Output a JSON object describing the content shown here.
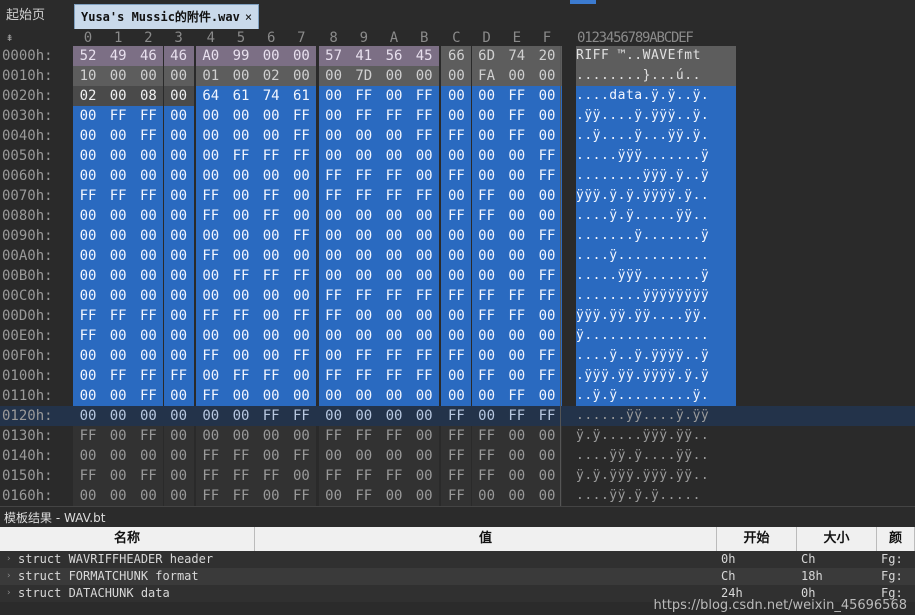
{
  "tabs": {
    "start": "起始页",
    "file": "Yusa's Mussic的附件.wav",
    "close": "×"
  },
  "column_headers": [
    "0",
    "1",
    "2",
    "3",
    "4",
    "5",
    "6",
    "7",
    "8",
    "9",
    "A",
    "B",
    "C",
    "D",
    "E",
    "F"
  ],
  "ascii_header": "0123456789ABCDEF",
  "scroll_up_icon": "⇞",
  "rows": [
    {
      "addr": "0000h:",
      "hex": [
        "52",
        "49",
        "46",
        "46",
        "A0",
        "99",
        "00",
        "00",
        "57",
        "41",
        "56",
        "45",
        "66",
        "6D",
        "74",
        "20"
      ],
      "ascii": "RIFF ™..WAVEfmt "
    },
    {
      "addr": "0010h:",
      "hex": [
        "10",
        "00",
        "00",
        "00",
        "01",
        "00",
        "02",
        "00",
        "00",
        "7D",
        "00",
        "00",
        "00",
        "FA",
        "00",
        "00"
      ],
      "ascii": "........}...ú.."
    },
    {
      "addr": "0020h:",
      "hex": [
        "02",
        "00",
        "08",
        "00",
        "64",
        "61",
        "74",
        "61",
        "00",
        "FF",
        "00",
        "FF",
        "00",
        "00",
        "FF",
        "00"
      ],
      "ascii": "....data.ÿ.ÿ..ÿ."
    },
    {
      "addr": "0030h:",
      "hex": [
        "00",
        "FF",
        "FF",
        "00",
        "00",
        "00",
        "00",
        "FF",
        "00",
        "FF",
        "FF",
        "FF",
        "00",
        "00",
        "FF",
        "00"
      ],
      "ascii": ".ÿÿ....ÿ.ÿÿÿ..ÿ."
    },
    {
      "addr": "0040h:",
      "hex": [
        "00",
        "00",
        "FF",
        "00",
        "00",
        "00",
        "00",
        "FF",
        "00",
        "00",
        "00",
        "FF",
        "FF",
        "00",
        "FF",
        "00"
      ],
      "ascii": "..ÿ....ÿ...ÿÿ.ÿ."
    },
    {
      "addr": "0050h:",
      "hex": [
        "00",
        "00",
        "00",
        "00",
        "00",
        "FF",
        "FF",
        "FF",
        "00",
        "00",
        "00",
        "00",
        "00",
        "00",
        "00",
        "FF"
      ],
      "ascii": ".....ÿÿÿ.......ÿ"
    },
    {
      "addr": "0060h:",
      "hex": [
        "00",
        "00",
        "00",
        "00",
        "00",
        "00",
        "00",
        "00",
        "FF",
        "FF",
        "FF",
        "00",
        "FF",
        "00",
        "00",
        "FF"
      ],
      "ascii": "........ÿÿÿ.ÿ..ÿ"
    },
    {
      "addr": "0070h:",
      "hex": [
        "FF",
        "FF",
        "FF",
        "00",
        "FF",
        "00",
        "FF",
        "00",
        "FF",
        "FF",
        "FF",
        "FF",
        "00",
        "FF",
        "00",
        "00"
      ],
      "ascii": "ÿÿÿ.ÿ.ÿ.ÿÿÿÿ.ÿ.."
    },
    {
      "addr": "0080h:",
      "hex": [
        "00",
        "00",
        "00",
        "00",
        "FF",
        "00",
        "FF",
        "00",
        "00",
        "00",
        "00",
        "00",
        "FF",
        "FF",
        "00",
        "00"
      ],
      "ascii": "....ÿ.ÿ.....ÿÿ.."
    },
    {
      "addr": "0090h:",
      "hex": [
        "00",
        "00",
        "00",
        "00",
        "00",
        "00",
        "00",
        "FF",
        "00",
        "00",
        "00",
        "00",
        "00",
        "00",
        "00",
        "FF"
      ],
      "ascii": ".......ÿ.......ÿ"
    },
    {
      "addr": "00A0h:",
      "hex": [
        "00",
        "00",
        "00",
        "00",
        "FF",
        "00",
        "00",
        "00",
        "00",
        "00",
        "00",
        "00",
        "00",
        "00",
        "00",
        "00"
      ],
      "ascii": "....ÿ..........."
    },
    {
      "addr": "00B0h:",
      "hex": [
        "00",
        "00",
        "00",
        "00",
        "00",
        "FF",
        "FF",
        "FF",
        "00",
        "00",
        "00",
        "00",
        "00",
        "00",
        "00",
        "FF"
      ],
      "ascii": ".....ÿÿÿ.......ÿ"
    },
    {
      "addr": "00C0h:",
      "hex": [
        "00",
        "00",
        "00",
        "00",
        "00",
        "00",
        "00",
        "00",
        "FF",
        "FF",
        "FF",
        "FF",
        "FF",
        "FF",
        "FF",
        "FF"
      ],
      "ascii": "........ÿÿÿÿÿÿÿÿ"
    },
    {
      "addr": "00D0h:",
      "hex": [
        "FF",
        "FF",
        "FF",
        "00",
        "FF",
        "FF",
        "00",
        "FF",
        "FF",
        "00",
        "00",
        "00",
        "00",
        "FF",
        "FF",
        "00"
      ],
      "ascii": "ÿÿÿ.ÿÿ.ÿÿ....ÿÿ."
    },
    {
      "addr": "00E0h:",
      "hex": [
        "FF",
        "00",
        "00",
        "00",
        "00",
        "00",
        "00",
        "00",
        "00",
        "00",
        "00",
        "00",
        "00",
        "00",
        "00",
        "00"
      ],
      "ascii": "ÿ..............."
    },
    {
      "addr": "00F0h:",
      "hex": [
        "00",
        "00",
        "00",
        "00",
        "FF",
        "00",
        "00",
        "FF",
        "00",
        "FF",
        "FF",
        "FF",
        "FF",
        "00",
        "00",
        "FF"
      ],
      "ascii": "....ÿ..ÿ.ÿÿÿÿ..ÿ"
    },
    {
      "addr": "0100h:",
      "hex": [
        "00",
        "FF",
        "FF",
        "FF",
        "00",
        "FF",
        "FF",
        "00",
        "FF",
        "FF",
        "FF",
        "FF",
        "00",
        "FF",
        "00",
        "FF"
      ],
      "ascii": ".ÿÿÿ.ÿÿ.ÿÿÿÿ.ÿ.ÿ"
    },
    {
      "addr": "0110h:",
      "hex": [
        "00",
        "00",
        "FF",
        "00",
        "FF",
        "00",
        "00",
        "00",
        "00",
        "00",
        "00",
        "00",
        "00",
        "00",
        "FF",
        "00"
      ],
      "ascii": "..ÿ.ÿ.........ÿ."
    },
    {
      "addr": "0120h:",
      "hex": [
        "00",
        "00",
        "00",
        "00",
        "00",
        "00",
        "FF",
        "FF",
        "00",
        "00",
        "00",
        "00",
        "FF",
        "00",
        "FF",
        "FF"
      ],
      "ascii": "......ÿÿ....ÿ.ÿÿ"
    },
    {
      "addr": "0130h:",
      "hex": [
        "FF",
        "00",
        "FF",
        "00",
        "00",
        "00",
        "00",
        "00",
        "FF",
        "FF",
        "FF",
        "00",
        "FF",
        "FF",
        "00",
        "00"
      ],
      "ascii": "ÿ.ÿ.....ÿÿÿ.ÿÿ.."
    },
    {
      "addr": "0140h:",
      "hex": [
        "00",
        "00",
        "00",
        "00",
        "FF",
        "FF",
        "00",
        "FF",
        "00",
        "00",
        "00",
        "00",
        "FF",
        "FF",
        "00",
        "00"
      ],
      "ascii": "....ÿÿ.ÿ....ÿÿ.."
    },
    {
      "addr": "0150h:",
      "hex": [
        "FF",
        "00",
        "FF",
        "00",
        "FF",
        "FF",
        "FF",
        "00",
        "FF",
        "FF",
        "FF",
        "00",
        "FF",
        "FF",
        "00",
        "00"
      ],
      "ascii": "ÿ.ÿ.ÿÿÿ.ÿÿÿ.ÿÿ.."
    },
    {
      "addr": "0160h:",
      "hex": [
        "00",
        "00",
        "00",
        "00",
        "FF",
        "FF",
        "00",
        "FF",
        "00",
        "FF",
        "00",
        "00",
        "FF",
        "00",
        "00",
        "00"
      ],
      "ascii": "....ÿÿ.ÿ.ÿ....."
    }
  ],
  "colors": {
    "riff_header": "#7c6f85",
    "fmt_chunk": "#5d5d5d",
    "data_tag": "#4a4a4a",
    "data_selected": "#2a6ac0",
    "cursor_row": "#23334a",
    "plain_cell": "#323232"
  },
  "panel": {
    "title": "模板结果 - WAV.bt",
    "columns": [
      "名称",
      "值",
      "开始",
      "大小",
      "颜"
    ],
    "rows": [
      {
        "name": "struct WAVRIFFHEADER header",
        "value": "",
        "start": "0h",
        "size": "Ch",
        "color": "Fg:"
      },
      {
        "name": "struct FORMATCHUNK format",
        "value": "",
        "start": "Ch",
        "size": "18h",
        "color": "Fg:"
      },
      {
        "name": "struct DATACHUNK data",
        "value": "",
        "start": "24h",
        "size": "0h",
        "color": "Fg:"
      }
    ]
  },
  "watermark": "https://blog.csdn.net/weixin_45696568"
}
